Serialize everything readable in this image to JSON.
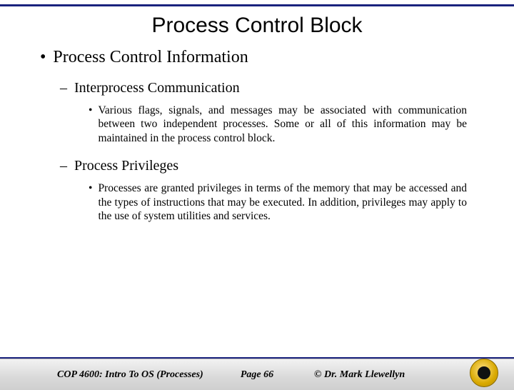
{
  "title": "Process Control Block",
  "level1": "Process Control Information",
  "sections": [
    {
      "heading": "Interprocess Communication",
      "body": "Various flags, signals, and messages may be associated with communication between two independent processes. Some or all of this information may be maintained in the process control block."
    },
    {
      "heading": "Process Privileges",
      "body": "Processes are granted privileges in terms of the memory that may be accessed and the types of instructions that may be executed. In addition, privileges may apply to the use of system utilities and services."
    }
  ],
  "footer": {
    "left": "COP 4600: Intro To OS  (Processes)",
    "center": "Page 66",
    "right": "© Dr. Mark Llewellyn"
  }
}
